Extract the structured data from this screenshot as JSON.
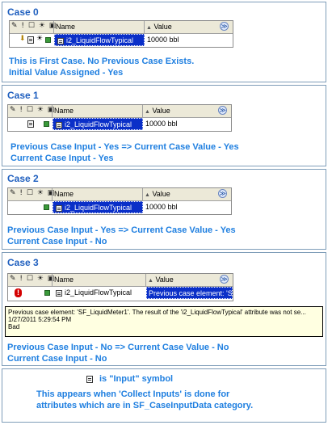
{
  "grid_header": {
    "icons": "✎ ! ☐ ☀ ▣",
    "name_col": "Name",
    "value_col": "Value",
    "chevron": "≫"
  },
  "cases": [
    {
      "title": "Case 0",
      "row": {
        "name": "i2_LiquidFlowTypical",
        "value": "10000 bbl",
        "name_selected": true,
        "value_selected": false
      },
      "description": [
        "This is First Case. No Previous Case Exists.",
        "Initial Value Assigned - Yes"
      ]
    },
    {
      "title": "Case 1",
      "row": {
        "name": "i2_LiquidFlowTypical",
        "value": "10000 bbl",
        "name_selected": true,
        "value_selected": false
      },
      "description": [
        "Previous Case Input - Yes => Current Case Value - Yes",
        "Current Case Input - Yes"
      ]
    },
    {
      "title": "Case 2",
      "row": {
        "name": "i2_LiquidFlowTypical",
        "value": "10000 bbl",
        "name_selected": true,
        "value_selected": false
      },
      "description": [
        "Previous Case Input - Yes => Current Case Value - Yes",
        "Current Case Input - No"
      ]
    },
    {
      "title": "Case 3",
      "row": {
        "name": "i2_LiquidFlowTypical",
        "value": "Previous case element: 'S...",
        "name_selected": false,
        "value_selected": true
      },
      "tooltip": [
        "Previous case element: 'SF_LiquidMeter1'. The result of the 'i2_LiquidFlowTypical' attribute was not se...",
        "1/27/2011 5:29:54 PM",
        "Bad"
      ],
      "description": [
        "Previous Case Input - No => Current Case Value - No",
        "Current Case Input - No"
      ]
    }
  ],
  "legend": {
    "symbol_label": "is \"Input\" symbol",
    "line1": "This appears when 'Collect Inputs' is done for",
    "line2": "attributes which are in SF_CaseInputData category."
  },
  "colors": {
    "title_blue": "#1f5fbf",
    "text_blue": "#1f7fe0",
    "selection_blue": "#0a2fc8",
    "bad_red": "#d40000",
    "tooltip_bg": "#ffffe1"
  }
}
